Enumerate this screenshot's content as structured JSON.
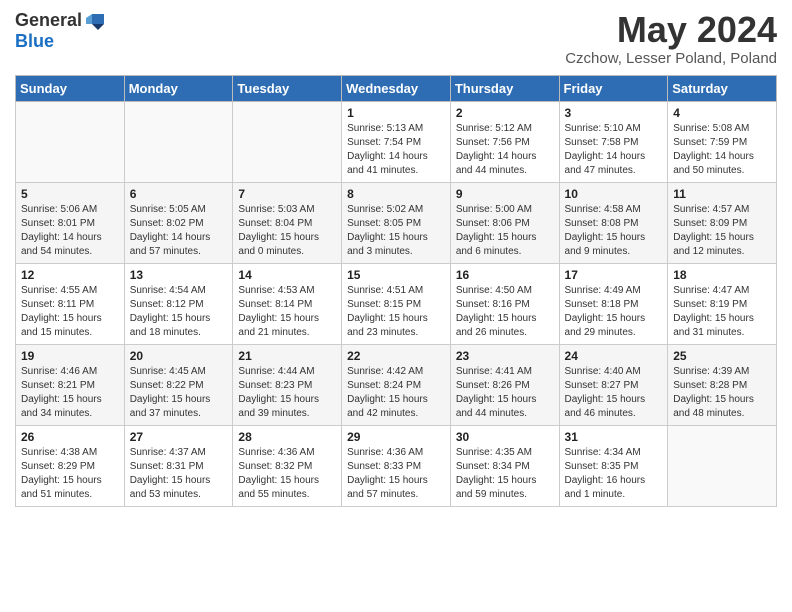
{
  "header": {
    "logo_general": "General",
    "logo_blue": "Blue",
    "title": "May 2024",
    "location": "Czchow, Lesser Poland, Poland"
  },
  "weekdays": [
    "Sunday",
    "Monday",
    "Tuesday",
    "Wednesday",
    "Thursday",
    "Friday",
    "Saturday"
  ],
  "weeks": [
    [
      {
        "day": "",
        "info": ""
      },
      {
        "day": "",
        "info": ""
      },
      {
        "day": "",
        "info": ""
      },
      {
        "day": "1",
        "info": "Sunrise: 5:13 AM\nSunset: 7:54 PM\nDaylight: 14 hours and 41 minutes."
      },
      {
        "day": "2",
        "info": "Sunrise: 5:12 AM\nSunset: 7:56 PM\nDaylight: 14 hours and 44 minutes."
      },
      {
        "day": "3",
        "info": "Sunrise: 5:10 AM\nSunset: 7:58 PM\nDaylight: 14 hours and 47 minutes."
      },
      {
        "day": "4",
        "info": "Sunrise: 5:08 AM\nSunset: 7:59 PM\nDaylight: 14 hours and 50 minutes."
      }
    ],
    [
      {
        "day": "5",
        "info": "Sunrise: 5:06 AM\nSunset: 8:01 PM\nDaylight: 14 hours and 54 minutes."
      },
      {
        "day": "6",
        "info": "Sunrise: 5:05 AM\nSunset: 8:02 PM\nDaylight: 14 hours and 57 minutes."
      },
      {
        "day": "7",
        "info": "Sunrise: 5:03 AM\nSunset: 8:04 PM\nDaylight: 15 hours and 0 minutes."
      },
      {
        "day": "8",
        "info": "Sunrise: 5:02 AM\nSunset: 8:05 PM\nDaylight: 15 hours and 3 minutes."
      },
      {
        "day": "9",
        "info": "Sunrise: 5:00 AM\nSunset: 8:06 PM\nDaylight: 15 hours and 6 minutes."
      },
      {
        "day": "10",
        "info": "Sunrise: 4:58 AM\nSunset: 8:08 PM\nDaylight: 15 hours and 9 minutes."
      },
      {
        "day": "11",
        "info": "Sunrise: 4:57 AM\nSunset: 8:09 PM\nDaylight: 15 hours and 12 minutes."
      }
    ],
    [
      {
        "day": "12",
        "info": "Sunrise: 4:55 AM\nSunset: 8:11 PM\nDaylight: 15 hours and 15 minutes."
      },
      {
        "day": "13",
        "info": "Sunrise: 4:54 AM\nSunset: 8:12 PM\nDaylight: 15 hours and 18 minutes."
      },
      {
        "day": "14",
        "info": "Sunrise: 4:53 AM\nSunset: 8:14 PM\nDaylight: 15 hours and 21 minutes."
      },
      {
        "day": "15",
        "info": "Sunrise: 4:51 AM\nSunset: 8:15 PM\nDaylight: 15 hours and 23 minutes."
      },
      {
        "day": "16",
        "info": "Sunrise: 4:50 AM\nSunset: 8:16 PM\nDaylight: 15 hours and 26 minutes."
      },
      {
        "day": "17",
        "info": "Sunrise: 4:49 AM\nSunset: 8:18 PM\nDaylight: 15 hours and 29 minutes."
      },
      {
        "day": "18",
        "info": "Sunrise: 4:47 AM\nSunset: 8:19 PM\nDaylight: 15 hours and 31 minutes."
      }
    ],
    [
      {
        "day": "19",
        "info": "Sunrise: 4:46 AM\nSunset: 8:21 PM\nDaylight: 15 hours and 34 minutes."
      },
      {
        "day": "20",
        "info": "Sunrise: 4:45 AM\nSunset: 8:22 PM\nDaylight: 15 hours and 37 minutes."
      },
      {
        "day": "21",
        "info": "Sunrise: 4:44 AM\nSunset: 8:23 PM\nDaylight: 15 hours and 39 minutes."
      },
      {
        "day": "22",
        "info": "Sunrise: 4:42 AM\nSunset: 8:24 PM\nDaylight: 15 hours and 42 minutes."
      },
      {
        "day": "23",
        "info": "Sunrise: 4:41 AM\nSunset: 8:26 PM\nDaylight: 15 hours and 44 minutes."
      },
      {
        "day": "24",
        "info": "Sunrise: 4:40 AM\nSunset: 8:27 PM\nDaylight: 15 hours and 46 minutes."
      },
      {
        "day": "25",
        "info": "Sunrise: 4:39 AM\nSunset: 8:28 PM\nDaylight: 15 hours and 48 minutes."
      }
    ],
    [
      {
        "day": "26",
        "info": "Sunrise: 4:38 AM\nSunset: 8:29 PM\nDaylight: 15 hours and 51 minutes."
      },
      {
        "day": "27",
        "info": "Sunrise: 4:37 AM\nSunset: 8:31 PM\nDaylight: 15 hours and 53 minutes."
      },
      {
        "day": "28",
        "info": "Sunrise: 4:36 AM\nSunset: 8:32 PM\nDaylight: 15 hours and 55 minutes."
      },
      {
        "day": "29",
        "info": "Sunrise: 4:36 AM\nSunset: 8:33 PM\nDaylight: 15 hours and 57 minutes."
      },
      {
        "day": "30",
        "info": "Sunrise: 4:35 AM\nSunset: 8:34 PM\nDaylight: 15 hours and 59 minutes."
      },
      {
        "day": "31",
        "info": "Sunrise: 4:34 AM\nSunset: 8:35 PM\nDaylight: 16 hours and 1 minute."
      },
      {
        "day": "",
        "info": ""
      }
    ]
  ]
}
